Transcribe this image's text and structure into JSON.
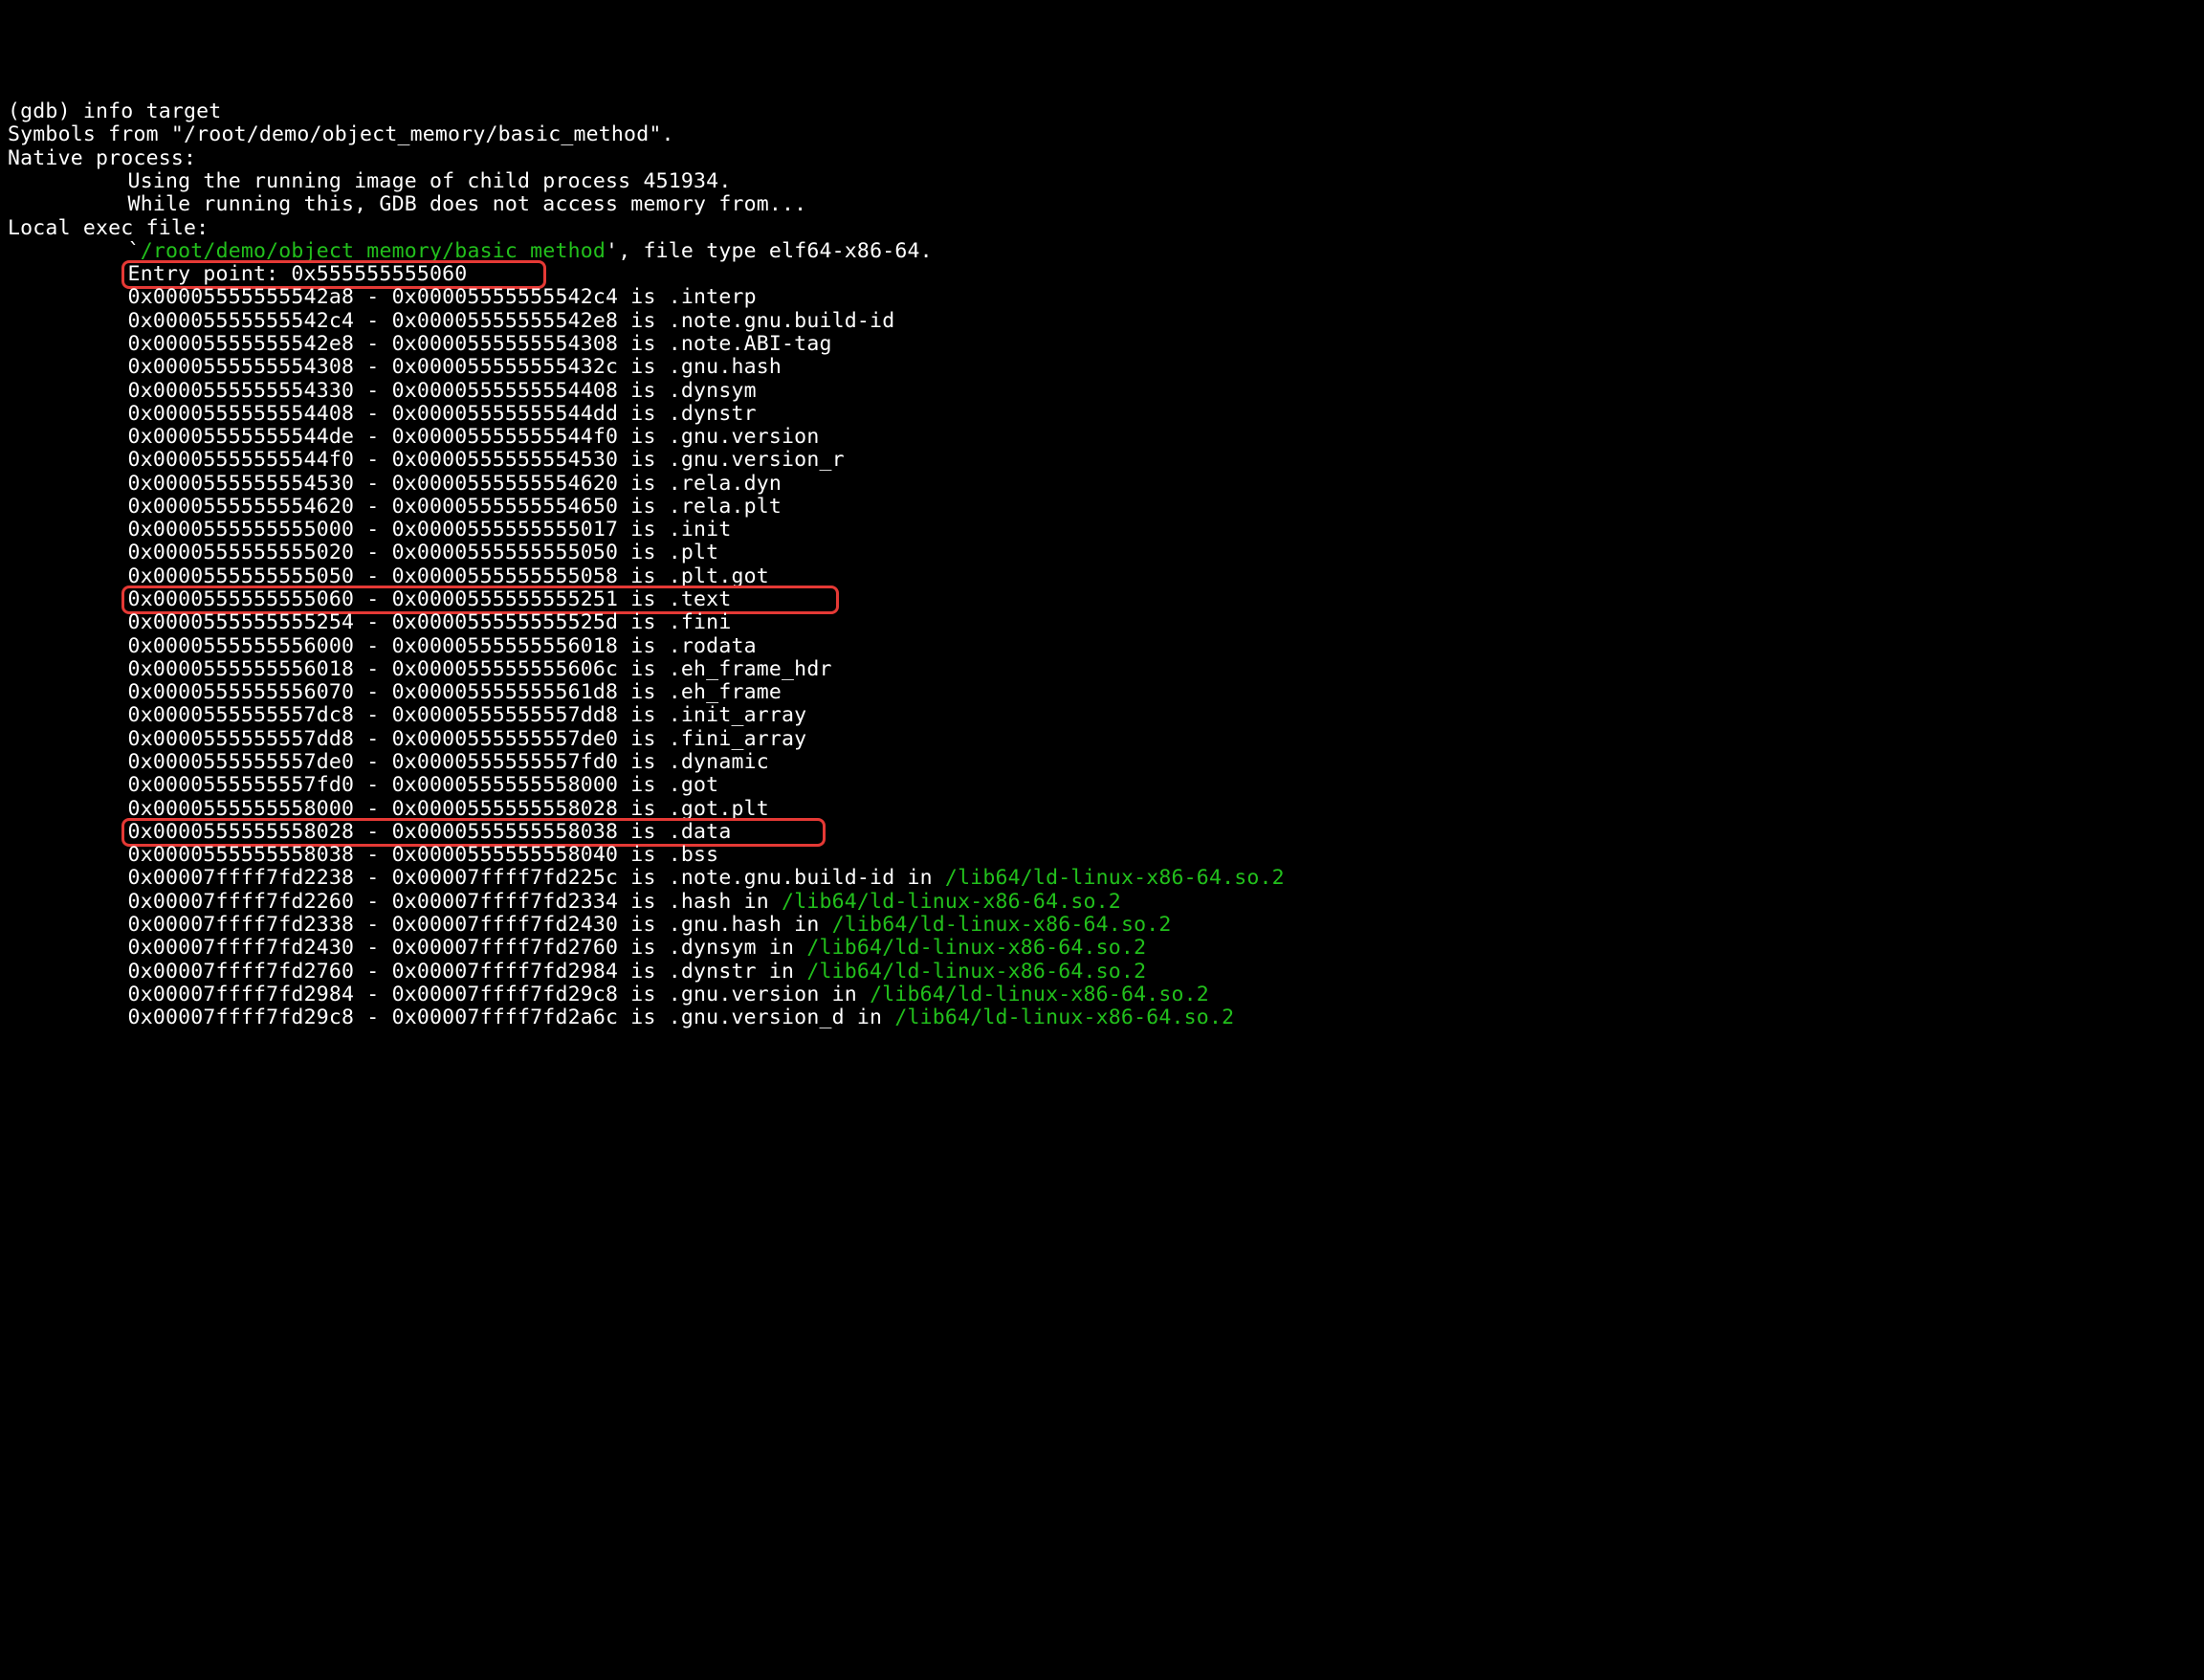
{
  "prompt": "(gdb) info target",
  "symbols_line": "Symbols from \"/root/demo/object_memory/basic_method\".",
  "native_header": "Native process:",
  "native_lines": [
    "Using the running image of child process 451934.",
    "While running this, GDB does not access memory from..."
  ],
  "local_header": "Local exec file:",
  "exec_path_prefix": "`",
  "exec_path": "/root/demo/object_memory/basic_method",
  "exec_path_suffix": "', file type elf64-x86-64.",
  "entry_line": "Entry point: 0x555555555060",
  "sections": [
    {
      "start": "0x00005555555542a8",
      "end": "0x00005555555542c4",
      "name": ".interp"
    },
    {
      "start": "0x00005555555542c4",
      "end": "0x00005555555542e8",
      "name": ".note.gnu.build-id"
    },
    {
      "start": "0x00005555555542e8",
      "end": "0x0000555555554308",
      "name": ".note.ABI-tag"
    },
    {
      "start": "0x0000555555554308",
      "end": "0x000055555555432c",
      "name": ".gnu.hash"
    },
    {
      "start": "0x0000555555554330",
      "end": "0x0000555555554408",
      "name": ".dynsym"
    },
    {
      "start": "0x0000555555554408",
      "end": "0x00005555555544dd",
      "name": ".dynstr"
    },
    {
      "start": "0x00005555555544de",
      "end": "0x00005555555544f0",
      "name": ".gnu.version"
    },
    {
      "start": "0x00005555555544f0",
      "end": "0x0000555555554530",
      "name": ".gnu.version_r"
    },
    {
      "start": "0x0000555555554530",
      "end": "0x0000555555554620",
      "name": ".rela.dyn"
    },
    {
      "start": "0x0000555555554620",
      "end": "0x0000555555554650",
      "name": ".rela.plt"
    },
    {
      "start": "0x0000555555555000",
      "end": "0x0000555555555017",
      "name": ".init"
    },
    {
      "start": "0x0000555555555020",
      "end": "0x0000555555555050",
      "name": ".plt"
    },
    {
      "start": "0x0000555555555050",
      "end": "0x0000555555555058",
      "name": ".plt.got"
    },
    {
      "start": "0x0000555555555060",
      "end": "0x0000555555555251",
      "name": ".text",
      "hl": true
    },
    {
      "start": "0x0000555555555254",
      "end": "0x000055555555525d",
      "name": ".fini"
    },
    {
      "start": "0x0000555555556000",
      "end": "0x0000555555556018",
      "name": ".rodata"
    },
    {
      "start": "0x0000555555556018",
      "end": "0x000055555555606c",
      "name": ".eh_frame_hdr"
    },
    {
      "start": "0x0000555555556070",
      "end": "0x00005555555561d8",
      "name": ".eh_frame"
    },
    {
      "start": "0x0000555555557dc8",
      "end": "0x0000555555557dd8",
      "name": ".init_array"
    },
    {
      "start": "0x0000555555557dd8",
      "end": "0x0000555555557de0",
      "name": ".fini_array"
    },
    {
      "start": "0x0000555555557de0",
      "end": "0x0000555555557fd0",
      "name": ".dynamic"
    },
    {
      "start": "0x0000555555557fd0",
      "end": "0x0000555555558000",
      "name": ".got"
    },
    {
      "start": "0x0000555555558000",
      "end": "0x0000555555558028",
      "name": ".got.plt"
    },
    {
      "start": "0x0000555555558028",
      "end": "0x0000555555558038",
      "name": ".data",
      "hl": true
    },
    {
      "start": "0x0000555555558038",
      "end": "0x0000555555558040",
      "name": ".bss"
    }
  ],
  "lib_sections": [
    {
      "start": "0x00007ffff7fd2238",
      "end": "0x00007ffff7fd225c",
      "name": ".note.gnu.build-id",
      "lib": "/lib64/ld-linux-x86-64.so.2"
    },
    {
      "start": "0x00007ffff7fd2260",
      "end": "0x00007ffff7fd2334",
      "name": ".hash",
      "lib": "/lib64/ld-linux-x86-64.so.2"
    },
    {
      "start": "0x00007ffff7fd2338",
      "end": "0x00007ffff7fd2430",
      "name": ".gnu.hash",
      "lib": "/lib64/ld-linux-x86-64.so.2"
    },
    {
      "start": "0x00007ffff7fd2430",
      "end": "0x00007ffff7fd2760",
      "name": ".dynsym",
      "lib": "/lib64/ld-linux-x86-64.so.2"
    },
    {
      "start": "0x00007ffff7fd2760",
      "end": "0x00007ffff7fd2984",
      "name": ".dynstr",
      "lib": "/lib64/ld-linux-x86-64.so.2"
    },
    {
      "start": "0x00007ffff7fd2984",
      "end": "0x00007ffff7fd29c8",
      "name": ".gnu.version",
      "lib": "/lib64/ld-linux-x86-64.so.2"
    },
    {
      "start": "0x00007ffff7fd29c8",
      "end": "0x00007ffff7fd2a6c",
      "name": ".gnu.version_d",
      "lib": "/lib64/ld-linux-x86-64.so.2"
    }
  ]
}
